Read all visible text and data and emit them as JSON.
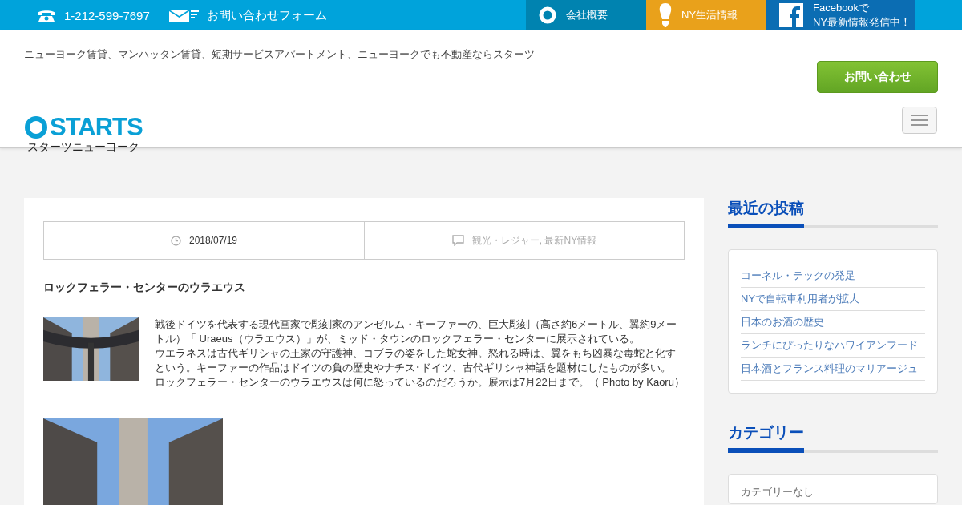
{
  "topbar": {
    "phone": "1-212-599-7697",
    "contact_form": "お問い合わせフォーム",
    "links": [
      {
        "kind": "company",
        "label": "会社概要",
        "color": "#0083b0"
      },
      {
        "kind": "life",
        "label": "NY生活情報",
        "color": "#e9a11b"
      },
      {
        "kind": "facebook",
        "label": "Facebookで\nNY最新情報発信中！",
        "color": "#0b6db3"
      }
    ]
  },
  "header": {
    "tagline": "ニューヨーク賃貸、マンハッタン賃貸、短期サービスアパートメント、ニューヨークでも不動産ならスターツ",
    "contact_button": "お問い合わせ",
    "logo": "STARTS",
    "logo_sub": "スターツニューヨーク"
  },
  "post": {
    "date": "2018/07/19",
    "categories": "観光・レジャー, 最新NY情報",
    "title": "ロックフェラー・センターのウラエウス",
    "body": [
      "戦後ドイツを代表する現代画家で彫刻家のアンゼルム・キーファーの、巨大彫刻（高さ約6メートル、翼約9メートル）「 Uraeus（ウラエウス）」が、ミッド・タウンのロックフェラー・センターに展示されている。",
      "ウエラネスは古代ギリシャの王家の守護神、コブラの姿をした蛇女神。怒れる時は、翼をもち凶暴な毒蛇と化すという。キーファーの作品はドイツの負の歴史やナチス･ドイツ、古代ギリシャ神話を題材にしたものが多い。",
      "ロックフェラー・センターのウラエウスは何に怒っているのだろうか。展示は7月22日まで。（ Photo by Kaoru）"
    ]
  },
  "sidebar": {
    "recent_title": "最近の投稿",
    "recent": [
      "コーネル・テックの発足",
      "NYで自転車利用者が拡大",
      "日本のお酒の歴史",
      "ランチにぴったりなハワイアンフード",
      "日本酒とフランス料理のマリアージュ"
    ],
    "category_title": "カテゴリー",
    "category_items": [
      "カテゴリーなし"
    ]
  }
}
